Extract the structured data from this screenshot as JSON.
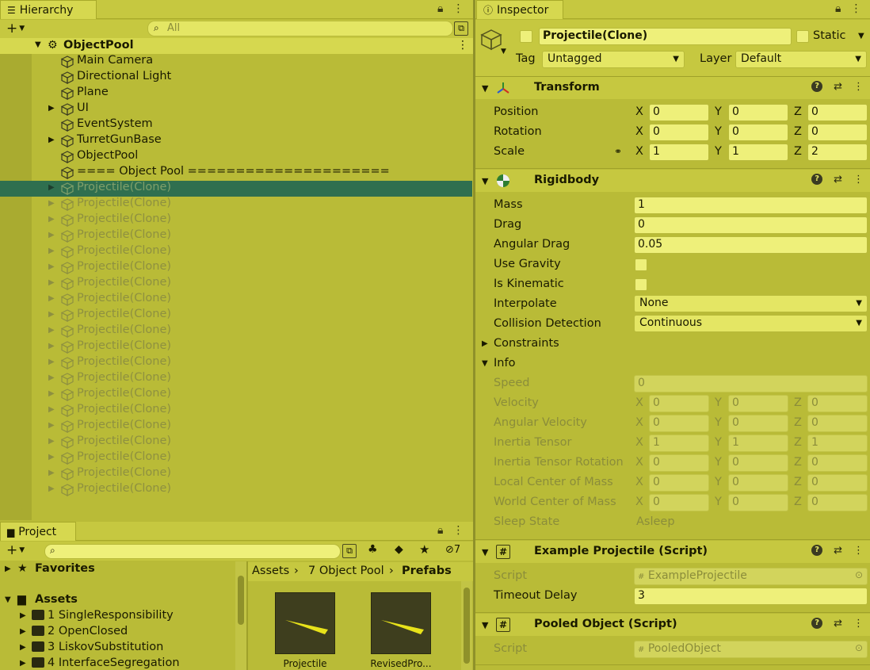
{
  "hierarchy": {
    "tab_label": "Hierarchy",
    "search_placeholder": "All",
    "root": "ObjectPool",
    "items": [
      {
        "label": "Main Camera",
        "expandable": false
      },
      {
        "label": "Directional Light",
        "expandable": false
      },
      {
        "label": "Plane",
        "expandable": false
      },
      {
        "label": "UI",
        "expandable": true
      },
      {
        "label": "EventSystem",
        "expandable": false
      },
      {
        "label": "TurretGunBase",
        "expandable": true
      },
      {
        "label": "ObjectPool",
        "expandable": false
      },
      {
        "label": "==== Object Pool =====================",
        "expandable": false
      }
    ],
    "clone_label": "Projectile(Clone)",
    "clone_count": 20
  },
  "project": {
    "tab_label": "Project",
    "hidden_count": "7",
    "favorites": "Favorites",
    "assets": "Assets",
    "folders": [
      "1 SingleResponsibility",
      "2 OpenClosed",
      "3 LiskovSubstitution",
      "4 InterfaceSegregation"
    ],
    "breadcrumb": [
      "Assets",
      "7 Object Pool",
      "Prefabs"
    ],
    "prefabs": [
      "Projectile",
      "RevisedPro..."
    ]
  },
  "inspector": {
    "tab_label": "Inspector",
    "object_name": "Projectile(Clone)",
    "static_label": "Static",
    "tag_label": "Tag",
    "tag_value": "Untagged",
    "layer_label": "Layer",
    "layer_value": "Default",
    "transform": {
      "title": "Transform",
      "rows": [
        {
          "label": "Position",
          "x": "0",
          "y": "0",
          "z": "0"
        },
        {
          "label": "Rotation",
          "x": "0",
          "y": "0",
          "z": "0"
        },
        {
          "label": "Scale",
          "x": "1",
          "y": "1",
          "z": "2"
        }
      ]
    },
    "rigidbody": {
      "title": "Rigidbody",
      "mass_label": "Mass",
      "mass": "1",
      "drag_label": "Drag",
      "drag": "0",
      "angular_drag_label": "Angular Drag",
      "angular_drag": "0.05",
      "use_gravity_label": "Use Gravity",
      "is_kinematic_label": "Is Kinematic",
      "interpolate_label": "Interpolate",
      "interpolate": "None",
      "collision_label": "Collision Detection",
      "collision": "Continuous",
      "constraints_label": "Constraints",
      "info_label": "Info",
      "speed_label": "Speed",
      "speed": "0",
      "info_rows": [
        {
          "label": "Velocity",
          "x": "0",
          "y": "0",
          "z": "0"
        },
        {
          "label": "Angular Velocity",
          "x": "0",
          "y": "0",
          "z": "0"
        },
        {
          "label": "Inertia Tensor",
          "x": "1",
          "y": "1",
          "z": "1"
        },
        {
          "label": "Inertia Tensor Rotation",
          "x": "0",
          "y": "0",
          "z": "0"
        },
        {
          "label": "Local Center of Mass",
          "x": "0",
          "y": "0",
          "z": "0"
        },
        {
          "label": "World Center of Mass",
          "x": "0",
          "y": "0",
          "z": "0"
        }
      ],
      "sleep_label": "Sleep State",
      "sleep": "Asleep"
    },
    "example_script": {
      "title": "Example Projectile (Script)",
      "script_label": "Script",
      "script": "ExampleProjectile",
      "timeout_label": "Timeout Delay",
      "timeout": "3"
    },
    "pooled_script": {
      "title": "Pooled Object (Script)",
      "script_label": "Script",
      "script": "PooledObject"
    },
    "axis_labels": {
      "x": "X",
      "y": "Y",
      "z": "Z"
    }
  },
  "colors": {
    "background": "#b9bb37",
    "selection": "#2f6f4f",
    "field": "#eef07a"
  }
}
